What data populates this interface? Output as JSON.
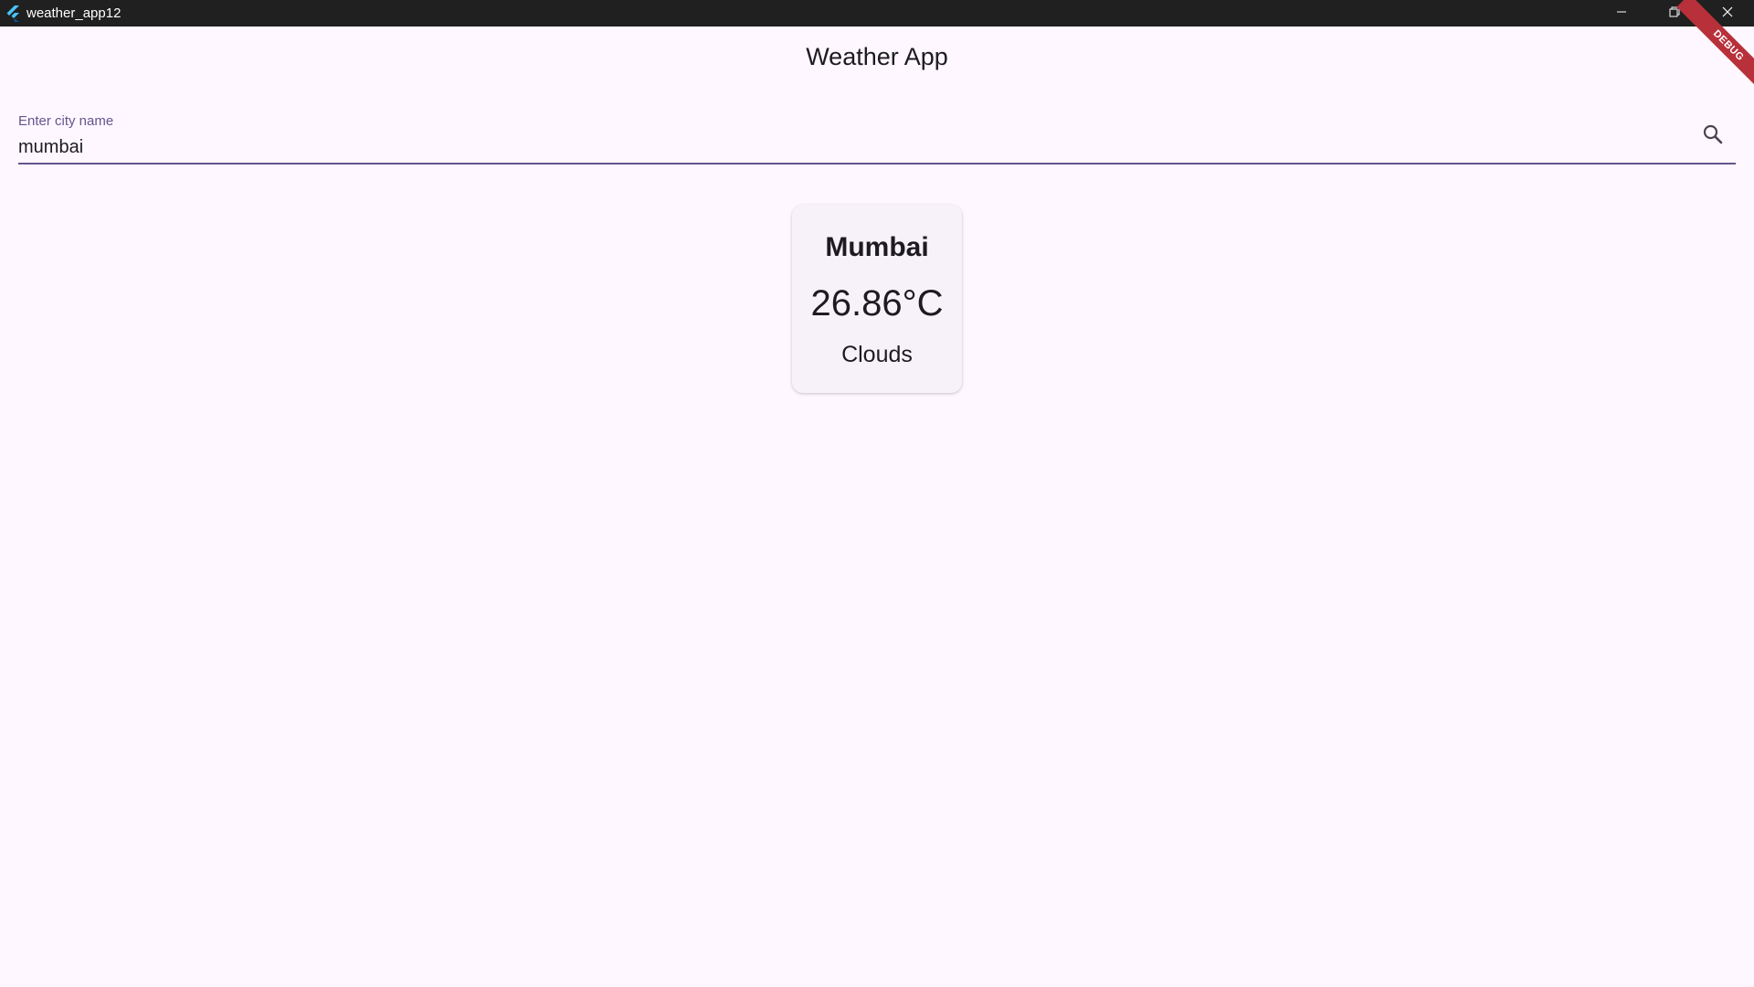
{
  "window": {
    "title": "weather_app12",
    "icon": "flutter-logo-icon",
    "controls": [
      "minimize-icon",
      "restore-icon",
      "close-icon"
    ]
  },
  "appbar": {
    "title": "Weather App"
  },
  "debug_banner": {
    "label": "DEBUG",
    "color": "#b7303a"
  },
  "search": {
    "label": "Enter city name",
    "value": "mumbai",
    "icon": "search-icon",
    "accent_color": "#65558f"
  },
  "weather_card": {
    "city": "Mumbai",
    "temperature": "26.86°C",
    "condition": "Clouds"
  },
  "colors": {
    "background": "#fef7ff",
    "titlebar": "#202020",
    "card": "#f7f2fa",
    "text": "#1d1b20"
  }
}
